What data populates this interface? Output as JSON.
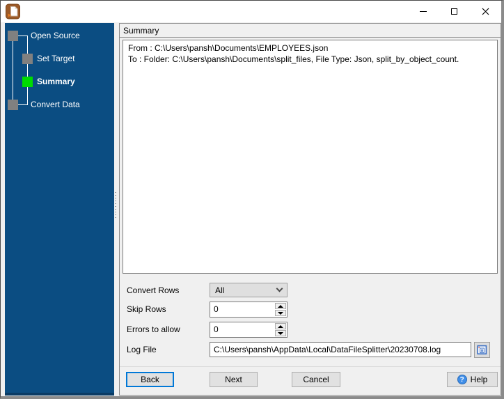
{
  "titlebar": {
    "app_icon": "data-file-splitter-icon",
    "controls": [
      "minimize",
      "maximize",
      "close"
    ]
  },
  "wizard": {
    "steps": [
      {
        "label": "Open Source",
        "state": "completed"
      },
      {
        "label": "Set Target",
        "state": "completed"
      },
      {
        "label": "Summary",
        "state": "current"
      },
      {
        "label": "Convert Data",
        "state": "upcoming"
      }
    ]
  },
  "summary_panel": {
    "header": "Summary",
    "lines": [
      "From : C:\\Users\\pansh\\Documents\\EMPLOYEES.json",
      "To : Folder: C:\\Users\\pansh\\Documents\\split_files, File Type: Json, split_by_object_count."
    ]
  },
  "form": {
    "convert_rows": {
      "label": "Convert Rows",
      "value": "All"
    },
    "skip_rows": {
      "label": "Skip Rows",
      "value": "0"
    },
    "errors_to_allow": {
      "label": "Errors to allow",
      "value": "0"
    },
    "log_file": {
      "label": "Log File",
      "value": "C:\\Users\\pansh\\AppData\\Local\\DataFileSplitter\\20230708.log"
    }
  },
  "buttons": {
    "back": "Back",
    "next": "Next",
    "cancel": "Cancel",
    "help": "Help",
    "help_icon_glyph": "?"
  },
  "colors": {
    "sidebar_background": "#0B4D82",
    "current_step_square": "#00DC00",
    "step_square": "#808080",
    "focus_border": "#0078D7",
    "titlebar_background": "#FFFFFF",
    "panel_background": "#F0F0F0"
  }
}
